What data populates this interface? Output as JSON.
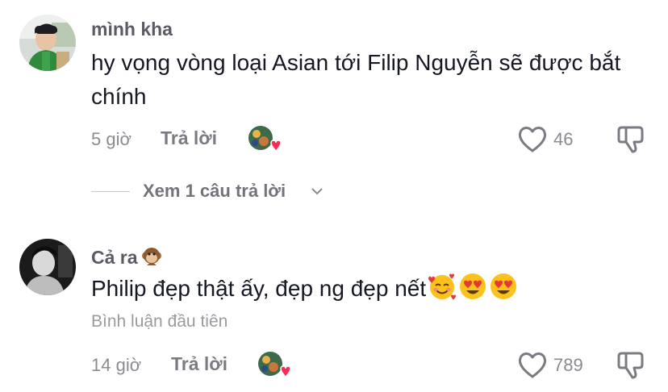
{
  "comments": [
    {
      "username": "mình kha",
      "text": "hy vọng vòng loại Asian tới Filip Nguyễn sẽ được bắt chính",
      "time": "5 giờ",
      "reply_label": "Trả lời",
      "like_count": "46",
      "view_replies_label": "Xem 1 câu trả lời"
    },
    {
      "username": "Cả ra",
      "username_emoji": "monkey-emoji",
      "text": "Philip đẹp thật ấy, đẹp ng đẹp nết",
      "text_emojis": [
        "smiling-face-with-hearts",
        "heart-eyes",
        "heart-eyes"
      ],
      "badge_label": "Bình luận đầu tiên",
      "time": "14 giờ",
      "reply_label": "Trả lời",
      "like_count": "789"
    }
  ],
  "colors": {
    "text": "#161823",
    "username": "#5b5b66",
    "meta": "#8a8b91",
    "heart": "#fe2c55"
  }
}
